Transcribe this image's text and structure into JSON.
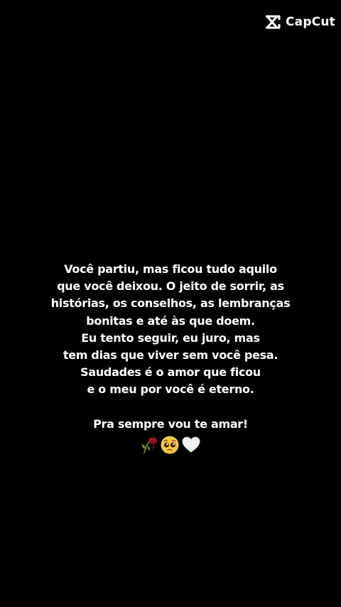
{
  "watermark": {
    "brand": "CapCut",
    "icon": "capcut-logo-icon"
  },
  "caption": {
    "lines": [
      "Você partiu, mas ficou tudo aquilo",
      "que você deixou. O jeito de sorrir, as",
      "histórias, os conselhos, as lembranças",
      "bonitas e até às que doem.",
      "Eu tento seguir, eu juro, mas",
      "tem dias que viver sem você pesa.",
      "Saudades é o amor que ficou",
      "e o meu por você é eterno."
    ],
    "closing": "Pra sempre vou te amar!",
    "emojis": [
      "wilted-rose-icon",
      "pleading-face-icon",
      "white-heart-icon"
    ]
  },
  "colors": {
    "background": "#000000",
    "text": "#ffffff"
  }
}
